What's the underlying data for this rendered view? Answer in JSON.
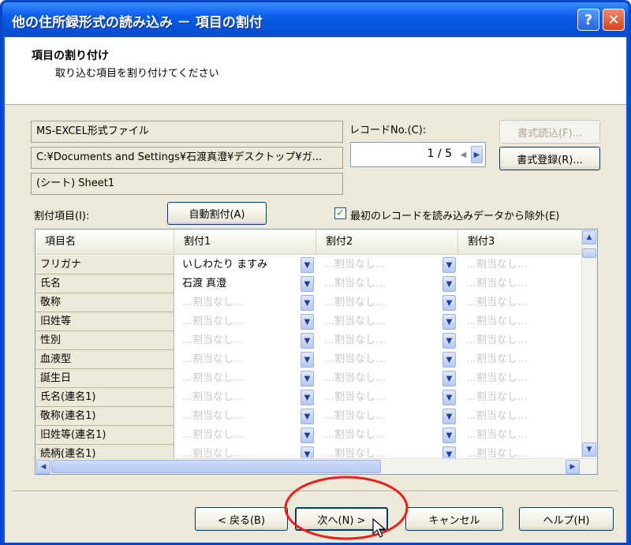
{
  "window": {
    "title": "他の住所録形式の読み込み － 項目の割付",
    "help_label": "?",
    "close_label": "✕"
  },
  "header": {
    "title": "項目の割り付け",
    "subtitle": "取り込む項目を割り付けてください"
  },
  "source": {
    "format": "MS-EXCEL形式ファイル",
    "path": "C:¥Documents and Settings¥石渡真澄¥デスクトップ¥ガ...",
    "sheet": "(シート) Sheet1"
  },
  "record": {
    "label": "レコードNo.(C):",
    "current": "1",
    "separator": "/",
    "total": "5"
  },
  "buttons": {
    "format_load": "書式読込(F)...",
    "format_register": "書式登録(R)...",
    "auto_assign": "自動割付(A)",
    "back": "< 戻る(B)",
    "next": "次へ(N) >",
    "cancel": "キャンセル",
    "help": "ヘルプ(H)"
  },
  "assign_label": "割付項目(I):",
  "exclude_first": {
    "label": "最初のレコードを読み込みデータから除外(E)",
    "checked": true
  },
  "grid": {
    "columns": [
      "項目名",
      "割付1",
      "割付2",
      "割付3"
    ],
    "rows": [
      {
        "name": "フリガナ",
        "cells": [
          "いしわたり ますみ",
          "…割当なし…",
          "…割当なし…"
        ]
      },
      {
        "name": "氏名",
        "cells": [
          "石渡 真澄",
          "…割当なし…",
          "…割当なし…"
        ]
      },
      {
        "name": "敬称",
        "cells": [
          "…割当なし…",
          "…割当なし…",
          "…割当なし…"
        ]
      },
      {
        "name": "旧姓等",
        "cells": [
          "…割当なし…",
          "…割当なし…",
          "…割当なし…"
        ]
      },
      {
        "name": "性別",
        "cells": [
          "…割当なし…",
          "…割当なし…",
          "…割当なし…"
        ]
      },
      {
        "name": "血液型",
        "cells": [
          "…割当なし…",
          "…割当なし…",
          "…割当なし…"
        ]
      },
      {
        "name": "誕生日",
        "cells": [
          "…割当なし…",
          "…割当なし…",
          "…割当なし…"
        ]
      },
      {
        "name": "氏名(連名1)",
        "cells": [
          "…割当なし…",
          "…割当なし…",
          "…割当なし…"
        ]
      },
      {
        "name": "敬称(連名1)",
        "cells": [
          "…割当なし…",
          "…割当なし…",
          "…割当なし…"
        ]
      },
      {
        "name": "旧姓等(連名1)",
        "cells": [
          "…割当なし…",
          "…割当なし…",
          "…割当なし…"
        ]
      },
      {
        "name": "続柄(連名1)",
        "cells": [
          "…割当なし…",
          "…割当なし…",
          "…割当なし…"
        ]
      }
    ]
  },
  "colors": {
    "titlebar": "#0a5cea",
    "dialog_bg": "#ece9d8",
    "highlight_ellipse": "#e8201e"
  }
}
